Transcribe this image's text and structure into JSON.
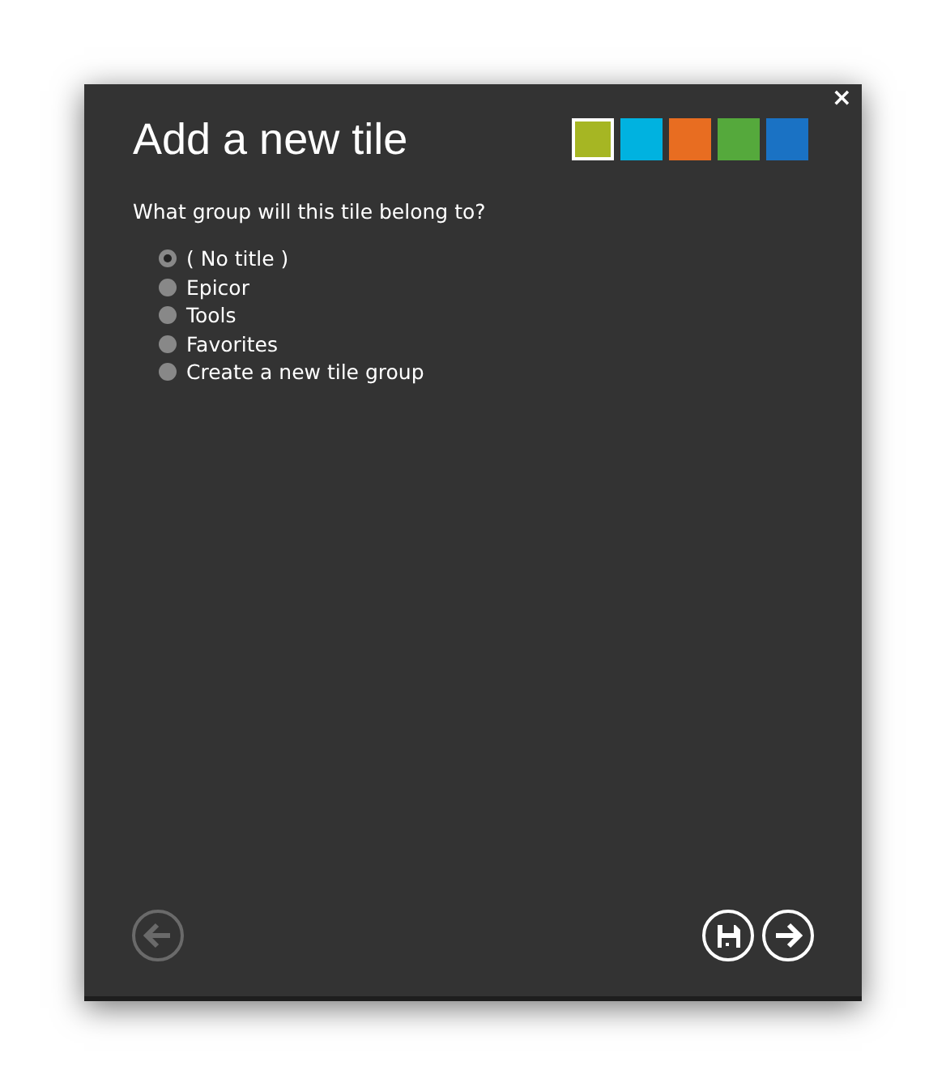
{
  "dialog": {
    "title": "Add a new tile",
    "close": "×",
    "question": "What group will this tile belong to?"
  },
  "colors": [
    {
      "color": "#a6b623",
      "selected": true
    },
    {
      "color": "#00b2e0",
      "selected": false
    },
    {
      "color": "#e86d21",
      "selected": false
    },
    {
      "color": "#55a93c",
      "selected": false
    },
    {
      "color": "#1a72c4",
      "selected": false
    }
  ],
  "groups": [
    {
      "label": "( No title )",
      "selected": true
    },
    {
      "label": "Epicor",
      "selected": false
    },
    {
      "label": "Tools",
      "selected": false
    },
    {
      "label": "Favorites",
      "selected": false
    },
    {
      "label": "Create a new tile group",
      "selected": false
    }
  ],
  "buttons": [
    {
      "kind": "back",
      "disabled": true
    },
    {
      "kind": "save",
      "disabled": false
    },
    {
      "kind": "next",
      "disabled": false
    }
  ]
}
